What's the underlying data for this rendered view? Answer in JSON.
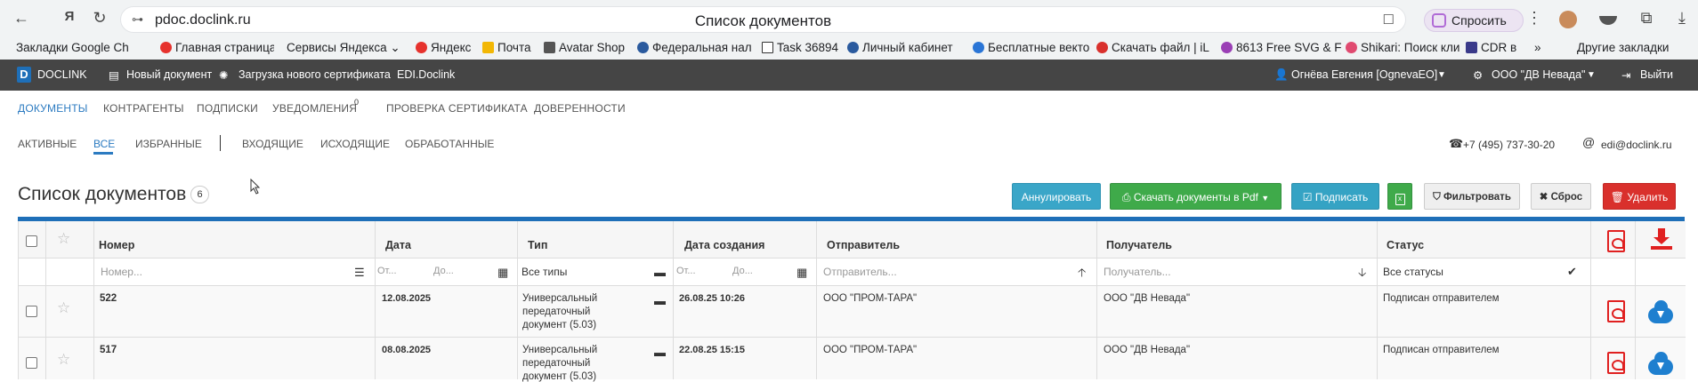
{
  "browser": {
    "url": "pdoc.doclink.ru",
    "page_title": "Список документов",
    "ask_label": "Спросить",
    "other_bookmarks": "Другие закладки",
    "bookmarks": [
      "Закладки Google Ch",
      "Главная страница",
      "Сервисы Яндекса",
      "Яндекс",
      "Почта",
      "Avatar Shop",
      "Федеральная нал",
      "Task 36894",
      "Личный кабинет",
      "Бесплатные векто",
      "Скачать файл | iL",
      "8613 Free SVG & F",
      "Shikari: Поиск кли",
      "CDR в"
    ]
  },
  "appnav": {
    "brand": "DOCLINK",
    "new_doc": "Новый документ",
    "upload_cert": "Загрузка нового сертификата",
    "edi": "EDI.Doclink",
    "user": "Огнёва Евгения [OgnevaEO]",
    "org": "ООО \"ДВ Невада\"",
    "logout": "Выйти"
  },
  "main_tabs": [
    "ДОКУМЕНТЫ",
    "КОНТРАГЕНТЫ",
    "ПОДПИСКИ",
    "УВЕДОМЛЕНИЯ",
    "ПРОВЕРКА СЕРТИФИКАТА",
    "ДОВЕРЕННОСТИ"
  ],
  "notifications_count": "0",
  "sub_tabs": [
    "АКТИВНЫЕ",
    "ВСЕ",
    "ИЗБРАННЫЕ",
    "ВХОДЯЩИЕ",
    "ИСХОДЯЩИЕ",
    "ОБРАБОТАННЫЕ"
  ],
  "contacts": {
    "phone": "+7 (495) 737-30-20",
    "email": "edi@doclink.ru"
  },
  "heading": "Список документов",
  "doc_count": "6",
  "buttons": {
    "annul": "Аннулировать",
    "download_pdf": "Скачать документы в Pdf",
    "sign": "Подписать",
    "filter": "Фильтровать",
    "reset": "Сброс",
    "delete": "Удалить"
  },
  "columns": [
    "Номер",
    "Дата",
    "Тип",
    "Дата создания",
    "Отправитель",
    "Получатель",
    "Статус"
  ],
  "filters": {
    "number": "Номер...",
    "date_from": "От...",
    "date_to": "До...",
    "type": "Все типы",
    "created_from": "От...",
    "created_to": "До...",
    "sender": "Отправитель...",
    "receiver": "Получатель...",
    "status": "Все статусы"
  },
  "rows": [
    {
      "number": "522",
      "date": "12.08.2025",
      "type_line1": "Универсальный",
      "type_line2": "передаточный",
      "type_line3": "документ (5.03)",
      "created": "26.08.25 10:26",
      "sender": "ООО \"ПРОМ-ТАРА\"",
      "receiver": "ООО \"ДВ Невада\"",
      "status": "Подписан отправителем"
    },
    {
      "number": "517",
      "date": "08.08.2025",
      "type_line1": "Универсальный",
      "type_line2": "передаточный",
      "type_line3": "документ (5.03)",
      "created": "22.08.25 15:15",
      "sender": "ООО \"ПРОМ-ТАРА\"",
      "receiver": "ООО \"ДВ Невада\"",
      "status": "Подписан отправителем"
    }
  ],
  "colors": {
    "primary_blue": "#1e6fb8",
    "annul": "#3aa6c8",
    "download": "#3faa4a",
    "sign": "#35a3c4",
    "delete": "#d9302c"
  }
}
